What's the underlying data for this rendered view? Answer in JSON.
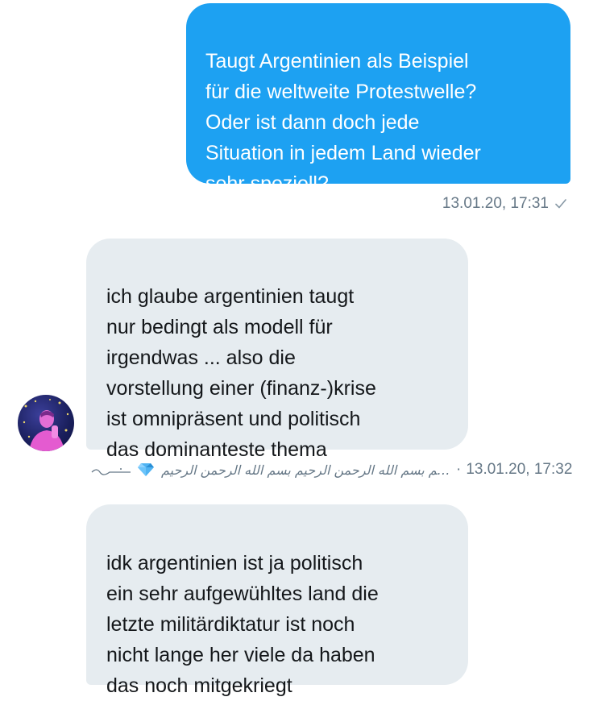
{
  "messages": {
    "outgoing": {
      "text": "Taugt Argentinien als Beispiel\nfür die weltweite Protestwelle?\nOder ist dann doch jede\nSituation in jedem Land wieder\nsehr speziell?",
      "timestamp": "13.01.20, 17:31"
    },
    "incoming_1": {
      "text": "ich glaube argentinien taugt\nnur bedingt als modell für\nirgendwas ... also die\nvorstellung einer (finanz-)krise\nist omnipräsent und politisch\ndas dominanteste thema"
    },
    "sender": {
      "name": "بسم الله الرحمن الرحيم بسم الله الرحمن الرحيم بسم الله الرحمن الرحيم بسم الله الرحمن الرحيم...",
      "separator": "·",
      "timestamp": "13.01.20, 17:32"
    },
    "incoming_2": {
      "text": "idk argentinien ist ja politisch\nein sehr aufgewühltes land die\nletzte militärdiktatur ist noch\nnicht lange her viele da haben\ndas noch mitgekriegt"
    }
  },
  "colors": {
    "outgoing_bubble": "#1da1f2",
    "incoming_bubble": "#e6ecf0",
    "meta_text": "#657786"
  },
  "icons": {
    "read_receipt": "check-icon",
    "name_emoji": "gem-icon"
  }
}
